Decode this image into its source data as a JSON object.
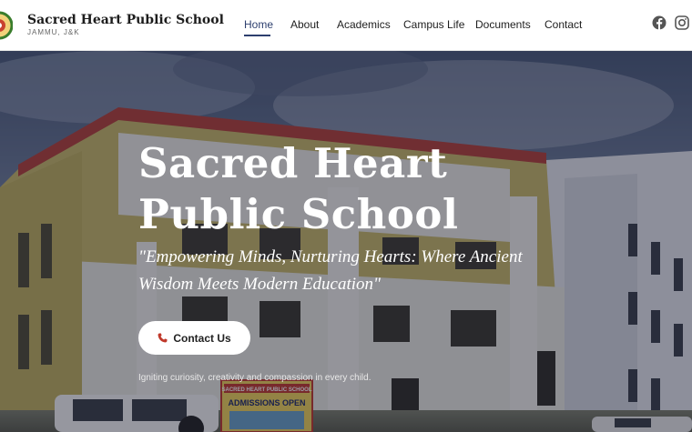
{
  "header": {
    "school_name": "Sacred Heart Public School",
    "location": "JAMMU, J&K",
    "logo_icon": "school-crest-icon"
  },
  "nav": {
    "items": [
      {
        "label": "Home",
        "active": true
      },
      {
        "label": "About",
        "active": false
      },
      {
        "label": "Academics",
        "active": false
      },
      {
        "label": "Campus Life",
        "active": false
      },
      {
        "label": "Documents",
        "active": false
      },
      {
        "label": "Contact",
        "active": false
      }
    ],
    "active_color": "#2d3f6e"
  },
  "social": {
    "facebook_icon": "facebook-icon",
    "instagram_icon": "instagram-icon"
  },
  "hero": {
    "title": "Sacred Heart Public School",
    "tagline": "\"Empowering Minds, Nurturing Hearts: Where Ancient Wisdom Meets Modern Education\"",
    "cta_label": "Contact Us",
    "cta_icon": "phone-icon",
    "cta_icon_color": "#c0392b",
    "caption": "Igniting curiosity, creativity and compassion in every child.",
    "banner_school": "SACRED HEART PUBLIC SCHOOL",
    "banner_admissions": "ADMISSIONS OPEN"
  }
}
